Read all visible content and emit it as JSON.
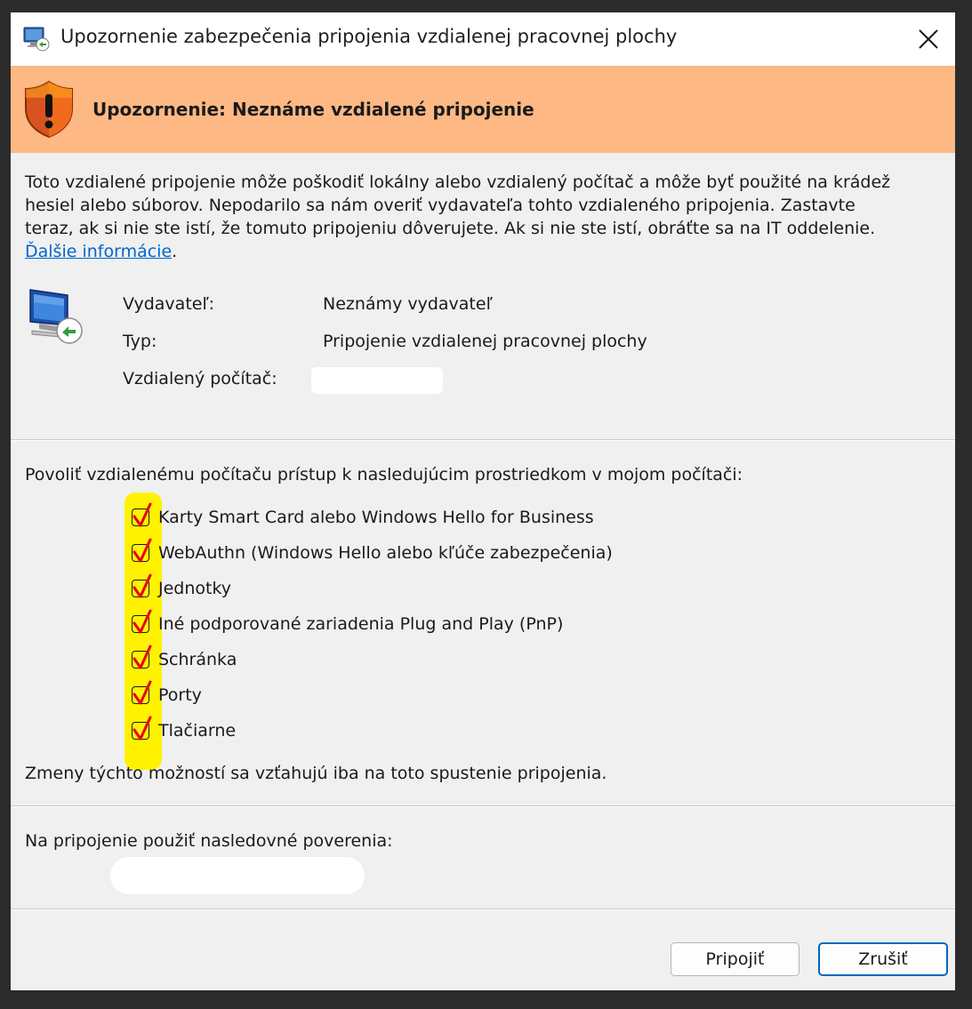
{
  "window": {
    "title": "Upozornenie zabezpečenia pripojenia vzdialenej pracovnej plochy"
  },
  "banner": {
    "text": "Upozornenie: Neznáme vzdialené pripojenie"
  },
  "warning": {
    "line1": "Toto vzdialené pripojenie môže poškodiť lokálny alebo vzdialený počítač a môže byť použité na krádež",
    "line2": "hesiel alebo súborov. Nepodarilo sa nám overiť vydavateľa tohto vzdialeného pripojenia. Zastavte",
    "line3": "teraz, ak si nie ste istí, že tomuto pripojeniu dôverujete. Ak si nie ste istí, obráťte sa na IT oddelenie.",
    "link": "Ďalšie informácie",
    "link_suffix": "."
  },
  "info": {
    "publisher_label": "Vydavateľ:",
    "publisher_value": "Neznámy vydavateľ",
    "type_label": "Typ:",
    "type_value": "Pripojenie vzdialenej pracovnej plochy",
    "computer_label": "Vzdialený počítač:"
  },
  "resources": {
    "heading": "Povoliť vzdialenému počítaču prístup k nasledujúcim prostriedkom v mojom počítači:",
    "items": [
      {
        "label": "Karty Smart Card alebo Windows Hello for Business",
        "checked": true
      },
      {
        "label": "WebAuthn (Windows Hello alebo kľúče zabezpečenia)",
        "checked": true
      },
      {
        "label": "Jednotky",
        "checked": true
      },
      {
        "label": "Iné podporované zariadenia Plug and Play (PnP)",
        "checked": true
      },
      {
        "label": "Schránka",
        "checked": true
      },
      {
        "label": "Porty",
        "checked": true
      },
      {
        "label": "Tlačiarne",
        "checked": true
      }
    ],
    "note": "Zmeny týchto možností sa vzťahujú iba na toto spustenie pripojenia."
  },
  "credentials": {
    "label": "Na pripojenie použiť nasledovné poverenia:"
  },
  "buttons": {
    "connect": "Pripojiť",
    "cancel": "Zrušiť"
  },
  "colors": {
    "banner": "#fdb884",
    "highlight": "#fff200",
    "check": "#e8001c",
    "link": "#0066cc",
    "primary_border": "#0067c0"
  },
  "icons": {
    "title": "remote-desktop-icon",
    "banner": "warning-shield-icon",
    "close": "close-icon",
    "computer": "remote-computer-icon",
    "check": "checkmark-icon"
  }
}
